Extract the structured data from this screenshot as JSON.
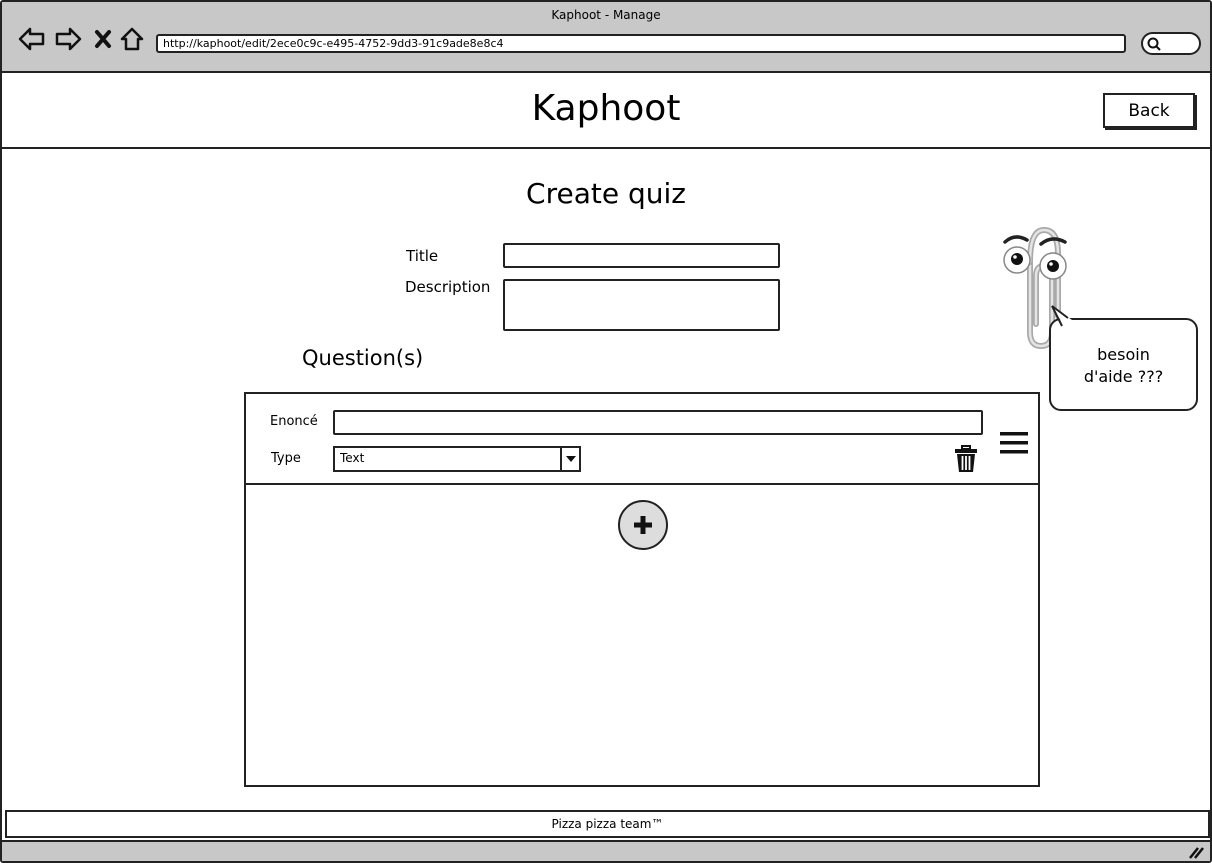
{
  "window": {
    "title": "Kaphoot - Manage"
  },
  "browser": {
    "url": "http://kaphoot/edit/2ece0c9c-e495-4752-9dd3-91c9ade8e8c4"
  },
  "header": {
    "brand": "Kaphoot",
    "back_label": "Back"
  },
  "form": {
    "heading": "Create quiz",
    "title_label": "Title",
    "title_value": "",
    "description_label": "Description",
    "description_value": ""
  },
  "questions": {
    "heading": "Question(s)",
    "items": [
      {
        "statement_label": "Enoncé",
        "statement_value": "",
        "type_label": "Type",
        "type_value": "Text"
      }
    ]
  },
  "helper": {
    "bubble_line1": "besoin",
    "bubble_line2": "d'aide ???"
  },
  "footer": {
    "text": "Pizza pizza team™"
  },
  "icons": {
    "back": "arrow-left-icon",
    "forward": "arrow-right-icon",
    "stop": "close-icon",
    "home": "home-icon",
    "search": "search-icon",
    "delete": "trash-icon",
    "drag": "menu-icon",
    "add": "plus-icon",
    "resize": "resize-grip-icon"
  },
  "colors": {
    "chrome": "#c8c8c8",
    "button_fill": "#dddddd",
    "stroke": "#222222"
  }
}
